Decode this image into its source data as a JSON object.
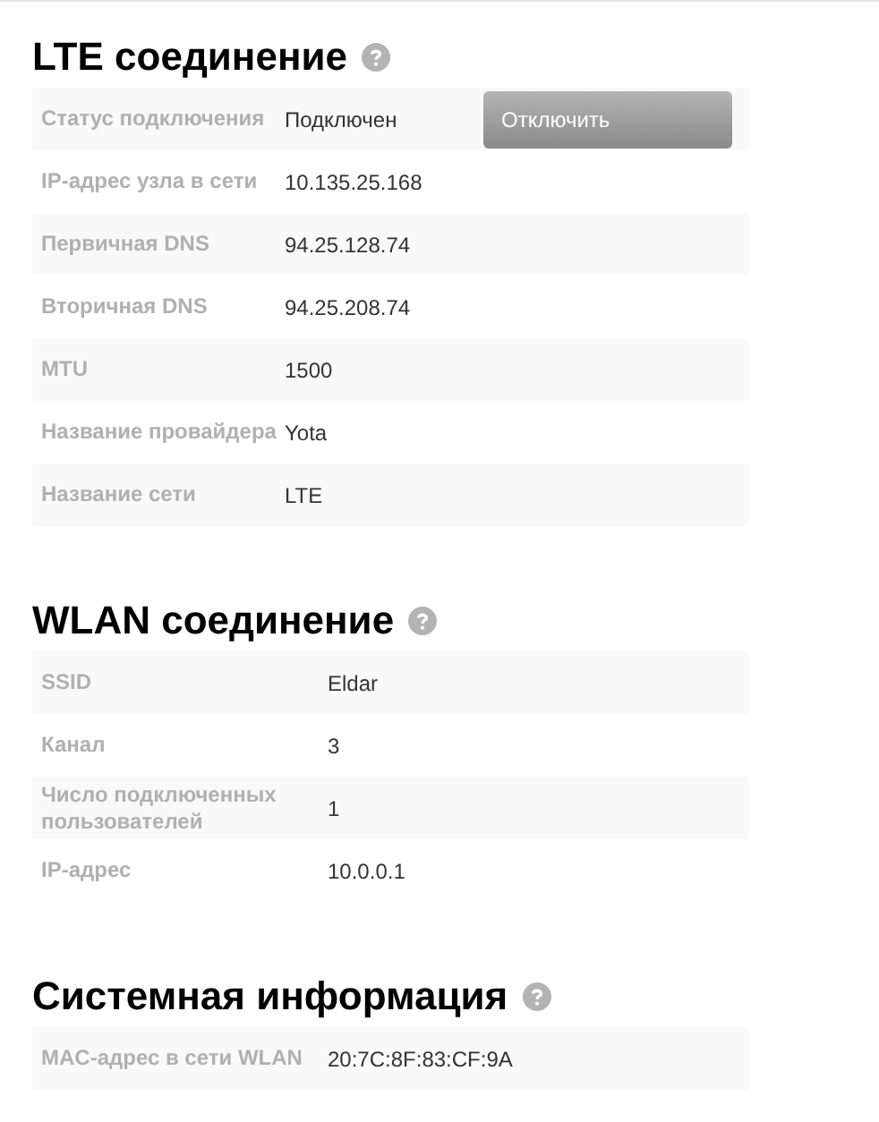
{
  "sections": [
    {
      "title": "LTE соединение",
      "rows": [
        {
          "label": "Статус подключения",
          "value": "Подключен",
          "action": "Отключить"
        },
        {
          "label": "IP-адрес узла в сети",
          "value": "10.135.25.168"
        },
        {
          "label": "Первичная DNS",
          "value": "94.25.128.74"
        },
        {
          "label": "Вторичная DNS",
          "value": "94.25.208.74"
        },
        {
          "label": "MTU",
          "value": "1500"
        },
        {
          "label": "Название провайдера",
          "value": "Yota"
        },
        {
          "label": "Название сети",
          "value": "LTE"
        }
      ]
    },
    {
      "title": "WLAN соединение",
      "rows": [
        {
          "label": "SSID",
          "value": "Eldar"
        },
        {
          "label": "Канал",
          "value": "3"
        },
        {
          "label": "Число подключенных пользователей",
          "value": "1"
        },
        {
          "label": "IP-адрес",
          "value": "10.0.0.1"
        }
      ]
    },
    {
      "title": "Системная информация",
      "rows": [
        {
          "label": "MAC-адрес в сети WLAN",
          "value": "20:7C:8F:83:CF:9A"
        }
      ]
    }
  ]
}
